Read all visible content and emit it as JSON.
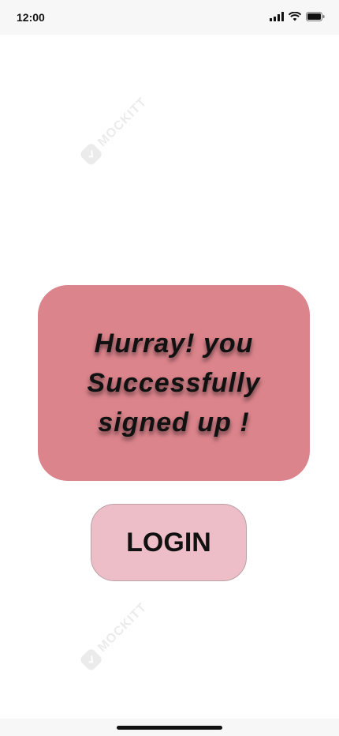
{
  "status_bar": {
    "time": "12:00",
    "icons": [
      "cellular-signal-icon",
      "wifi-icon",
      "battery-icon"
    ]
  },
  "watermark": {
    "text": "MOCKITT"
  },
  "success_card": {
    "message": "Hurray! you Successfully signed up !",
    "background_color": "#dc848c"
  },
  "login_button": {
    "label": "LOGIN",
    "background_color": "#eebec8"
  }
}
